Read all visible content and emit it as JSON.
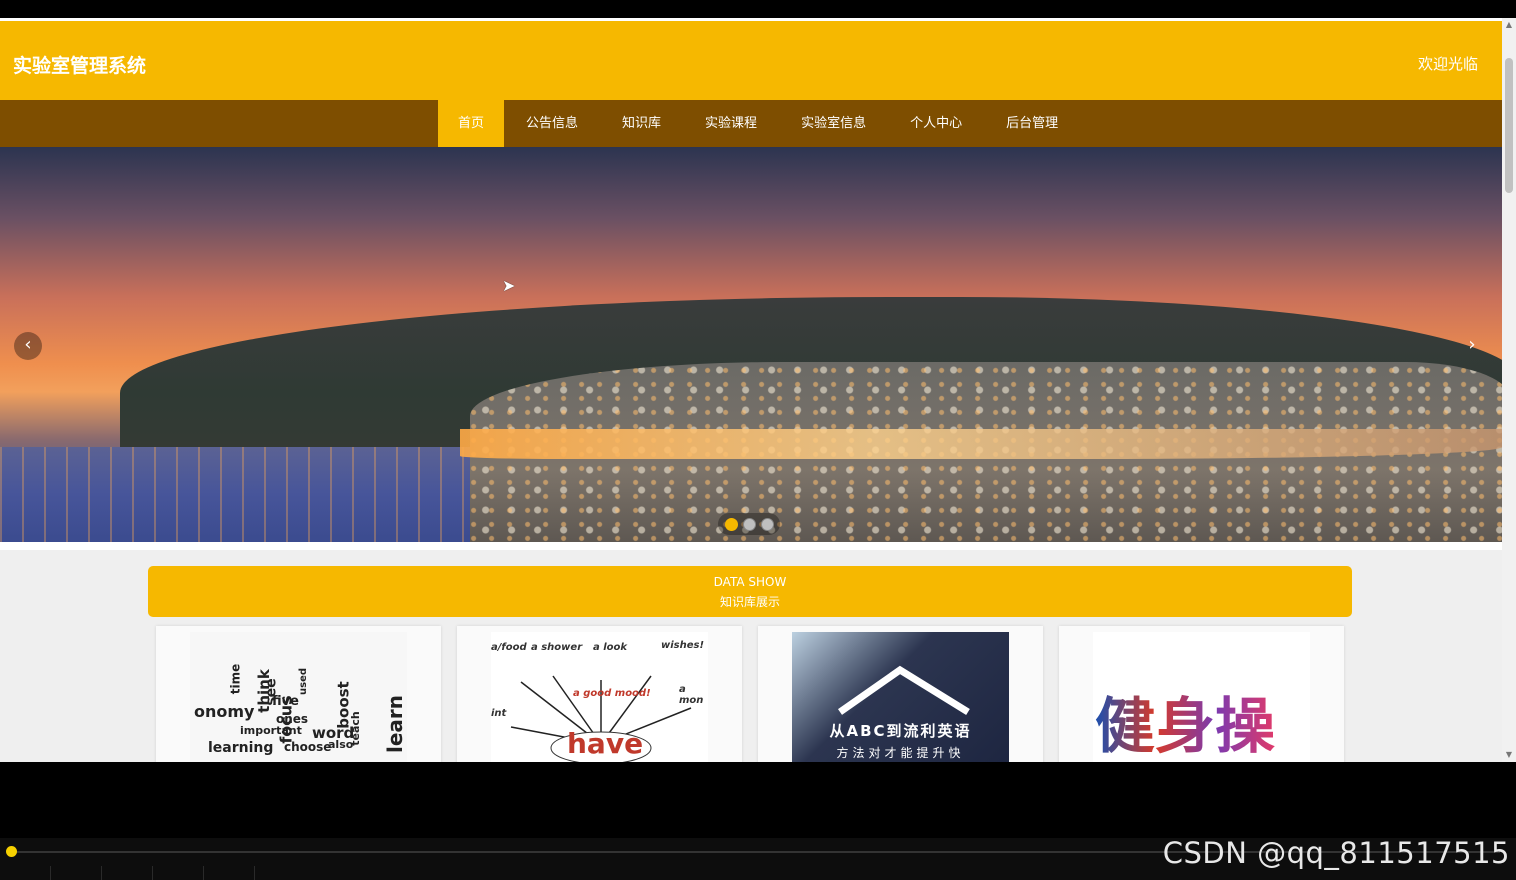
{
  "header": {
    "title": "实验室管理系统",
    "welcome": "欢迎光临"
  },
  "nav": {
    "items": [
      {
        "label": "首页",
        "active": true
      },
      {
        "label": "公告信息"
      },
      {
        "label": "知识库"
      },
      {
        "label": "实验课程"
      },
      {
        "label": "实验室信息"
      },
      {
        "label": "个人中心"
      },
      {
        "label": "后台管理"
      }
    ]
  },
  "carousel": {
    "prev_icon": "chevron-left-icon",
    "next_icon": "chevron-right-icon",
    "prev_glyph": "‹",
    "next_glyph": "›",
    "dots": 3,
    "active_index": 0
  },
  "section": {
    "title_en": "DATA SHOW",
    "title_zh": "知识库展示"
  },
  "cards": [
    {
      "words": [
        "time",
        "think",
        "see",
        "onomy",
        "focus",
        "five",
        "boost",
        "learn",
        "important",
        "word",
        "learning",
        "choose",
        "also",
        "used",
        "ones",
        "teach"
      ]
    },
    {
      "labels": [
        "a/food",
        "a shower",
        "a look",
        "wishes!",
        "a good mood!",
        "a mon",
        "int"
      ],
      "center": "have"
    },
    {
      "line1": "从ABC到流利英语",
      "line2": "方法对才能提升快"
    },
    {
      "calligraphy": "健身操"
    }
  ],
  "player": {
    "progress": 0
  },
  "watermark": "CSDN @qq_811517515",
  "colors": {
    "primary": "#f6b800",
    "nav_bg": "#7e4e00"
  }
}
